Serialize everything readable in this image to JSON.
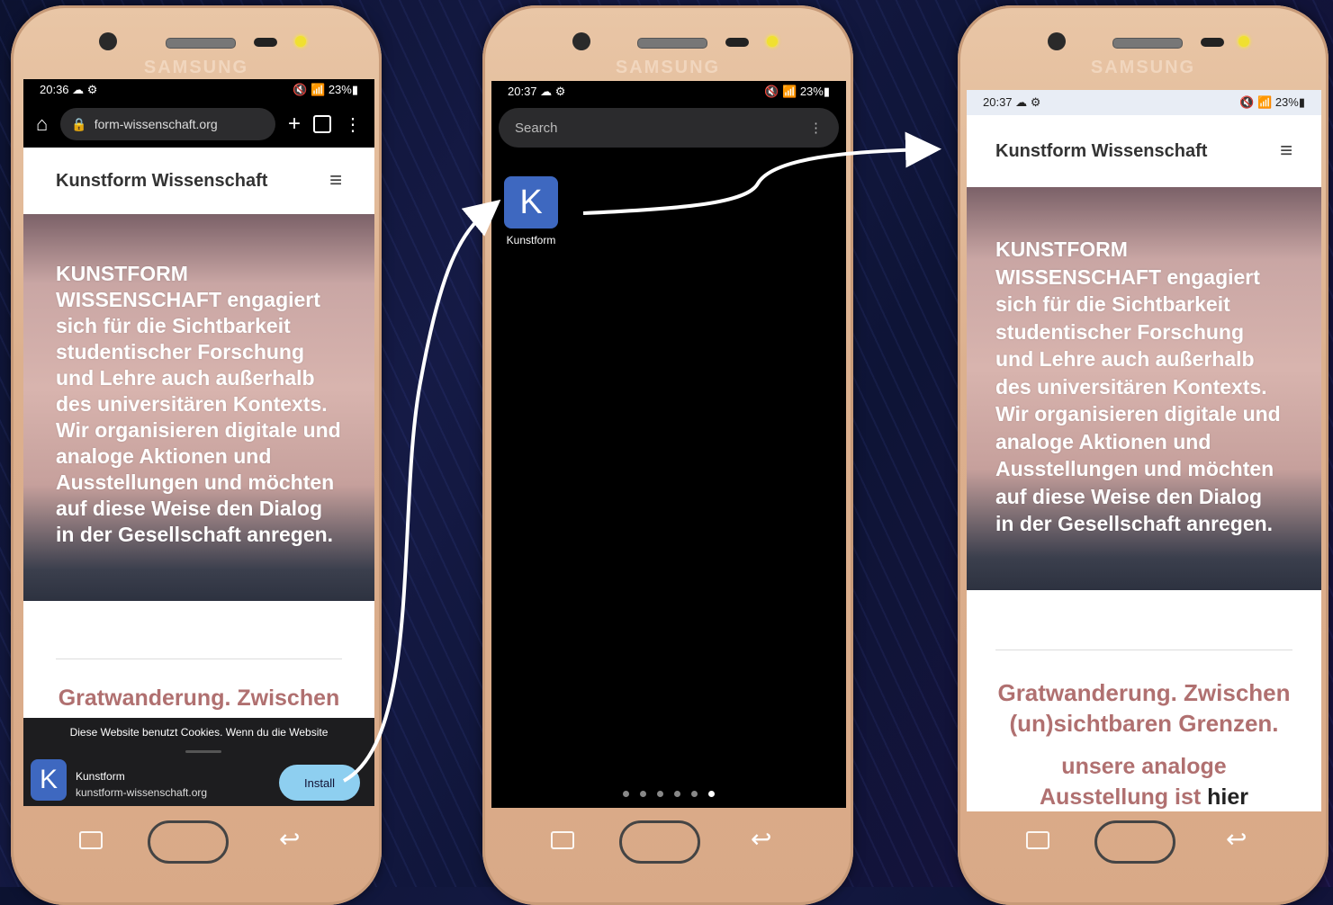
{
  "phone1": {
    "brand": "SAMSUNG",
    "status": {
      "time": "20:36",
      "battery": "23%"
    },
    "chrome": {
      "url": "form-wissenschaft.org"
    },
    "site": {
      "title": "Kunstform Wissenschaft",
      "hero_text": "KUNSTFORM\nWISSENSCHAFT engagiert\nsich für die Sichtbarkeit\nstudentischer Forschung\nund Lehre auch außerhalb\ndes universitären Kontexts.\nWir organisieren digitale und\nanaloge Aktionen und\nAusstellungen und möchten\nauf diese Weise den Dialog\nin der Gesellschaft anregen.",
      "section_title": "Gratwanderung. Zwischen"
    },
    "cookie_text": "Diese Website benutzt Cookies. Wenn du die Website",
    "install": {
      "app_letter": "K",
      "app_name": "Kunstform",
      "app_url": "kunstform-wissenschaft.org",
      "button": "Install"
    }
  },
  "phone2": {
    "brand": "SAMSUNG",
    "status": {
      "time": "20:37",
      "battery": "23%"
    },
    "search_placeholder": "Search",
    "app": {
      "letter": "K",
      "label": "Kunstform"
    },
    "page_dots": 6,
    "active_dot": 6
  },
  "phone3": {
    "brand": "SAMSUNG",
    "status": {
      "time": "20:37",
      "battery": "23%"
    },
    "site": {
      "title": "Kunstform Wissenschaft",
      "hero_text": "KUNSTFORM\nWISSENSCHAFT engagiert\nsich für die Sichtbarkeit\nstudentischer Forschung\nund Lehre auch außerhalb\ndes universitären Kontexts.\nWir organisieren digitale und\nanaloge Aktionen und\nAusstellungen und möchten\nauf diese Weise den Dialog\nin der Gesellschaft anregen.",
      "section_title": "Gratwanderung. Zwischen\n(un)sichtbaren Grenzen.",
      "sub_line1": "unsere analoge",
      "sub_line2_a": "Ausstellung ist ",
      "sub_line2_b": "hier"
    }
  },
  "colors": {
    "accent_red": "#b07070",
    "install_blue": "#8ecff0",
    "icon_blue": "#3e68c0"
  }
}
